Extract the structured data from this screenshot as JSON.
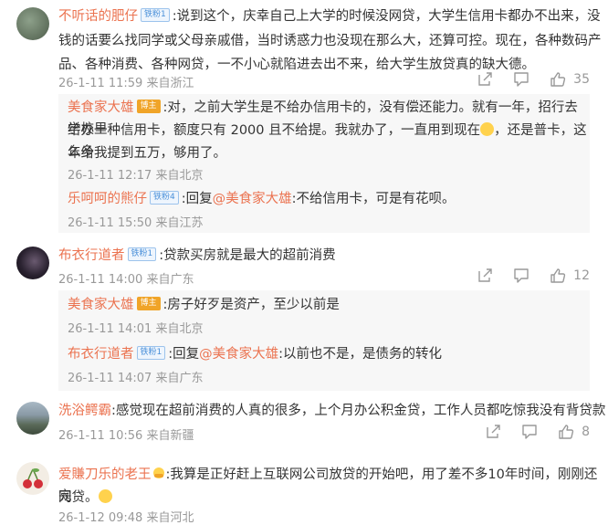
{
  "comments": [
    {
      "user": "不听话的肥仔",
      "badge": "铁粉1",
      "line1": ":说到这个，庆幸自己上大学的时候没网贷，大学生信用卡都办不出来，没",
      "line2": "钱的话要么找同学或父母亲戚借，当时诱惑力也没现在那么大，还算可控。现在，各种数码产",
      "line3": "品、各种消费、各种网贷，一不小心就陷进去出不来，给大学生放贷真的缺大德。",
      "meta": "26-1-11 11:59 来自浙江",
      "likes": "35",
      "replies": [
        {
          "user": "美食家大雄",
          "badge": "博主",
          "line1": ":对，之前大学生是不给办信用卡的，没有偿还能力。就有一年，招行去学校里",
          "line2a": "给办一种信用卡，额度只有 2000 且不给提。我就办了，一直用到现在",
          "line2b": "，还是普卡，这么多",
          "line3": "年给我提到五万，够用了。",
          "meta": "26-1-11 12:17 来自北京"
        },
        {
          "user": "乐呵呵的熊仔",
          "badge": "铁粉4",
          "prefix": ":回复",
          "mention": "@美食家大雄",
          "text": ":不给信用卡，可是有花呗。",
          "meta": "26-1-11 15:50 来自江苏"
        }
      ]
    },
    {
      "user": "布衣行道者",
      "badge": "铁粉1",
      "line1": ":贷款买房就是最大的超前消费",
      "meta": "26-1-11 14:00 来自广东",
      "likes": "12",
      "replies": [
        {
          "user": "美食家大雄",
          "badge": "博主",
          "text": ":房子好歹是资产，至少以前是",
          "meta": "26-1-11 14:01 来自北京"
        },
        {
          "user": "布衣行道者",
          "badge": "铁粉1",
          "prefix": ":回复",
          "mention": "@美食家大雄",
          "text": ":以前也不是，是债务的转化",
          "meta": "26-1-11 14:07 来自广东"
        }
      ]
    },
    {
      "user": "洗浴鳄霸",
      "line1": ":感觉现在超前消费的人真的很多，上个月办公积金贷，工作人员都吃惊我没有背贷款",
      "meta": "26-1-11 10:56 来自新疆",
      "likes": "8"
    },
    {
      "user": "爱賺刀乐的老王",
      "line1": ":我算是正好赶上互联网公司放贷的开始吧，用了差不多10年时间，刚刚还完",
      "line2": "网贷。",
      "meta": "26-1-12 09:48 来自河北"
    }
  ],
  "icons": [
    "share-icon",
    "comment-icon",
    "like-icon"
  ],
  "colors": {
    "username": "#eb7350",
    "meta": "#999999",
    "reply_bg": "#f7f7f7",
    "fan_badge": "#4a90d9",
    "author_badge": "#f0a428"
  }
}
